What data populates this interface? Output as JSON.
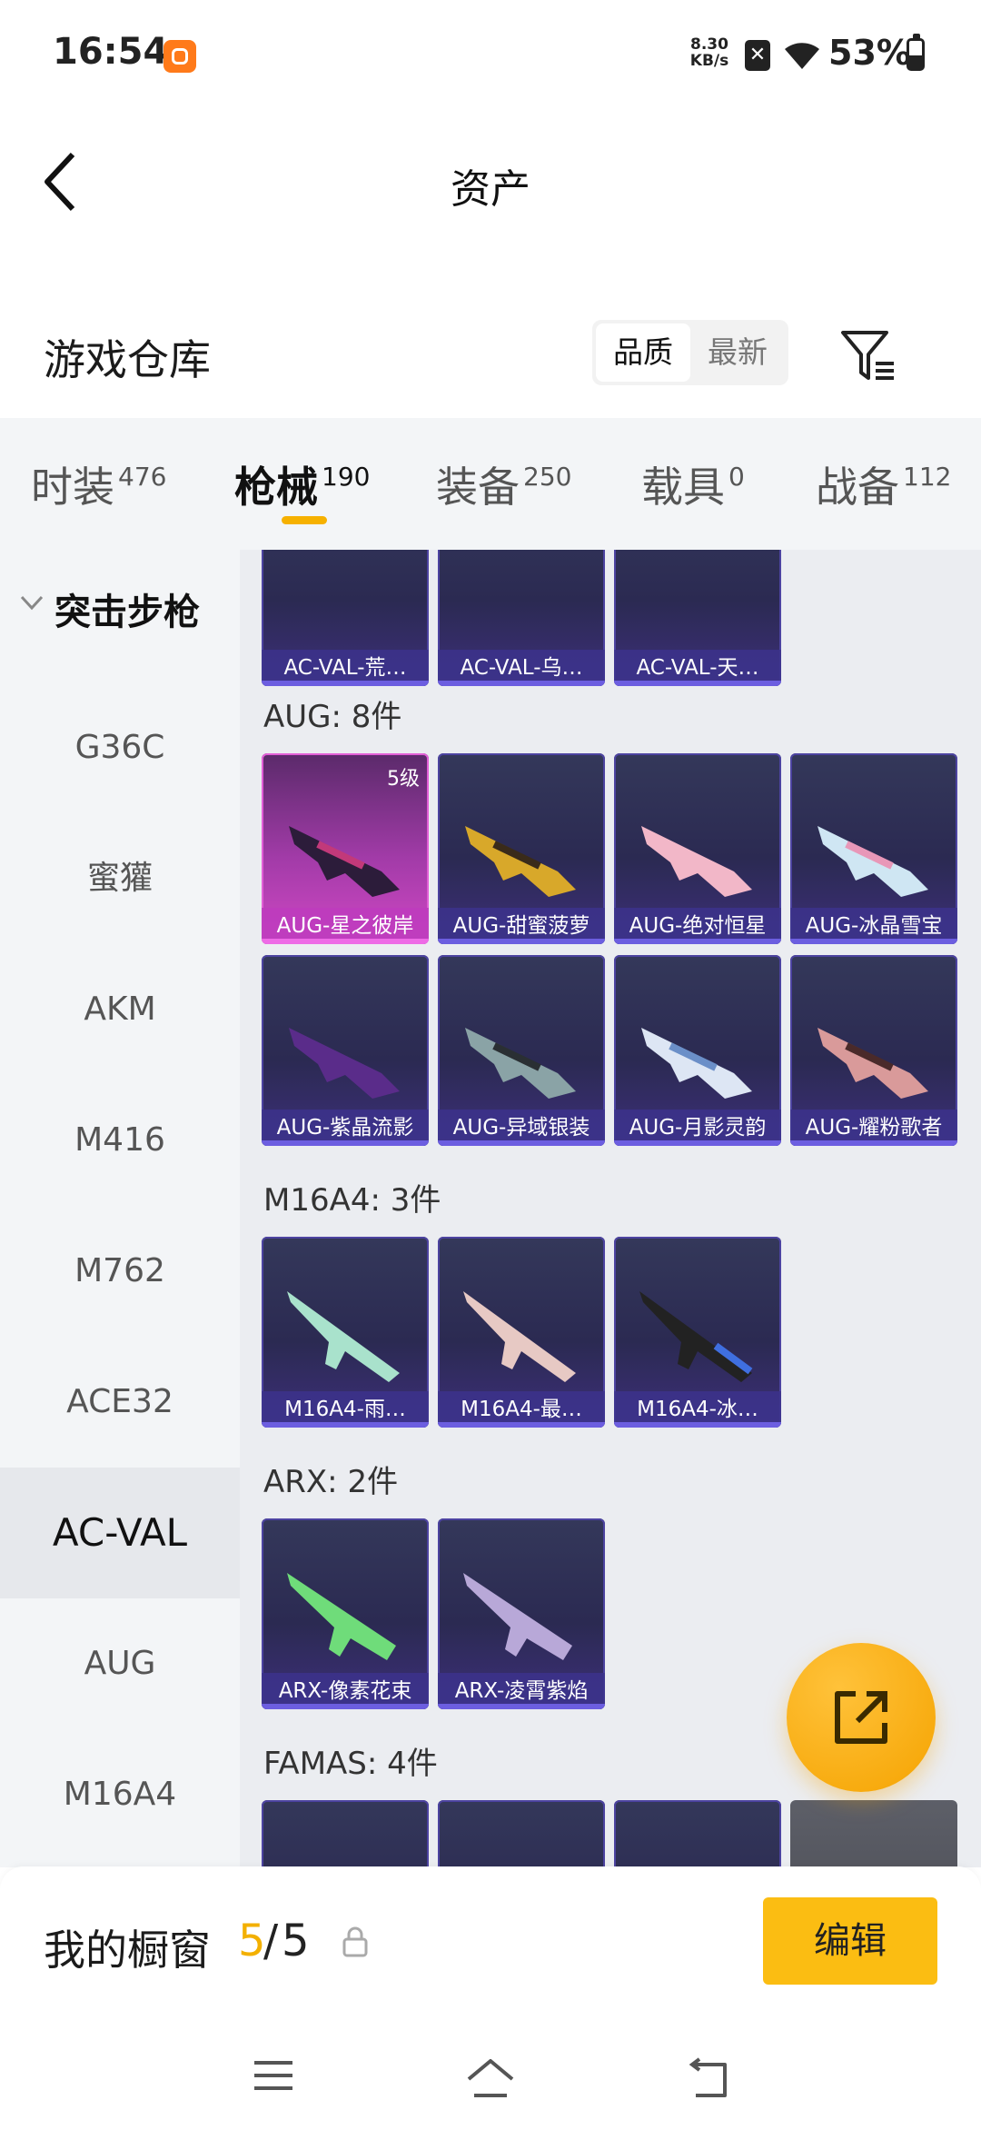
{
  "status_bar": {
    "time": "16:54",
    "net_speed_value": "8.30",
    "net_speed_unit": "KB/s",
    "battery": "53%"
  },
  "nav": {
    "title": "资产"
  },
  "warehouse": {
    "title": "游戏仓库",
    "sort": {
      "active": "品质",
      "inactive": "最新"
    }
  },
  "tabs": [
    {
      "label": "时装",
      "count": "476"
    },
    {
      "label": "枪械",
      "count": "190"
    },
    {
      "label": "装备",
      "count": "250"
    },
    {
      "label": "载具",
      "count": "0"
    },
    {
      "label": "战备",
      "count": "112"
    }
  ],
  "sidebar": {
    "group": "突击步枪",
    "items": [
      "G36C",
      "蜜獾",
      "AKM",
      "M416",
      "M762",
      "ACE32",
      "AC-VAL",
      "AUG",
      "M16A4"
    ],
    "active": "AC-VAL"
  },
  "content": {
    "acval_cards": [
      "AC-VAL-荒…",
      "AC-VAL-乌…",
      "AC-VAL-天…"
    ],
    "aug": {
      "label": "AUG: 8件",
      "level_badge": "5级",
      "cards": [
        "AUG-星之彼岸",
        "AUG-甜蜜菠萝",
        "AUG-绝对恒星",
        "AUG-冰晶雪宝",
        "AUG-紫晶流影",
        "AUG-异域银装",
        "AUG-月影灵韵",
        "AUG-耀粉歌者"
      ]
    },
    "m16a4": {
      "label": "M16A4: 3件",
      "cards": [
        "M16A4-雨…",
        "M16A4-最…",
        "M16A4-冰…"
      ]
    },
    "arx": {
      "label": "ARX: 2件",
      "cards": [
        "ARX-像素花束",
        "ARX-凌霄紫焰"
      ]
    },
    "famas": {
      "label": "FAMAS: 4件"
    }
  },
  "showcase": {
    "label": "我的橱窗",
    "current": "5",
    "sep": "/",
    "total": "5",
    "edit": "编辑"
  },
  "colors": {
    "accent": "#fbbd12",
    "card_purple": "#2b2a52",
    "card_pink": "#d048c4"
  },
  "icons": [
    "back-arrow-icon",
    "filter-icon",
    "chevron-down-icon",
    "share-icon",
    "lock-icon",
    "menu-icon",
    "home-icon",
    "return-icon",
    "wifi-icon",
    "battery-icon"
  ]
}
